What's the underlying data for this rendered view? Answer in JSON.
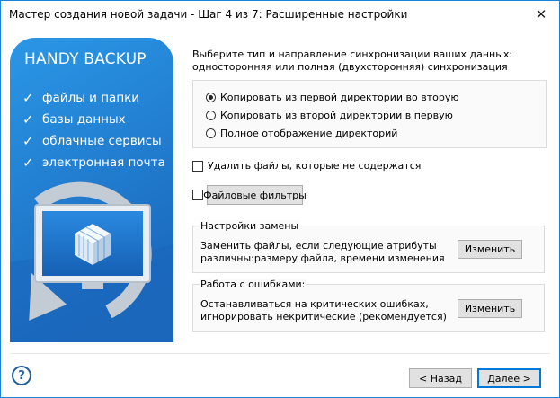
{
  "window": {
    "title": "Мастер создания новой задачи - Шаг 4 из 7: Расширенные настройки",
    "close_glyph": "✕"
  },
  "banner": {
    "brand": "HANDY BACKUP",
    "check_glyph": "✓",
    "features": [
      "файлы и папки",
      "базы данных",
      "облачные сервисы",
      "электронная почта"
    ],
    "colors": {
      "top": "#2a8ee0",
      "bottom": "#1b6fc2",
      "accent": "#b9c3cc"
    }
  },
  "main": {
    "description": "Выберите тип и направление синхронизации ваших данных: односторонняя или полная (двухсторонняя) синхронизация",
    "sync_options": [
      {
        "label": "Копировать из первой директории во вторую",
        "selected": true
      },
      {
        "label": "Копировать из второй директории в первую",
        "selected": false
      },
      {
        "label": "Полное отображение директорий",
        "selected": false
      }
    ],
    "delete_files_label": "Удалить файлы, которые не содержатся",
    "file_filters_label": "Файловые фильтры",
    "replace_group": {
      "title": "Настройки замены",
      "line1": "Заменить файлы, если следующие атрибуты",
      "line2": "различны:размеру файла, времени изменения",
      "button": "Изменить"
    },
    "error_group": {
      "title": "Работа с ошибками:",
      "line1": "Останавливаться на критических ошибках,",
      "line2": "игнорировать некритические (рекомендуется)",
      "button": "Изменить"
    }
  },
  "footer": {
    "help_glyph": "?",
    "back_label": "< Назад",
    "next_label": "Далее >"
  }
}
